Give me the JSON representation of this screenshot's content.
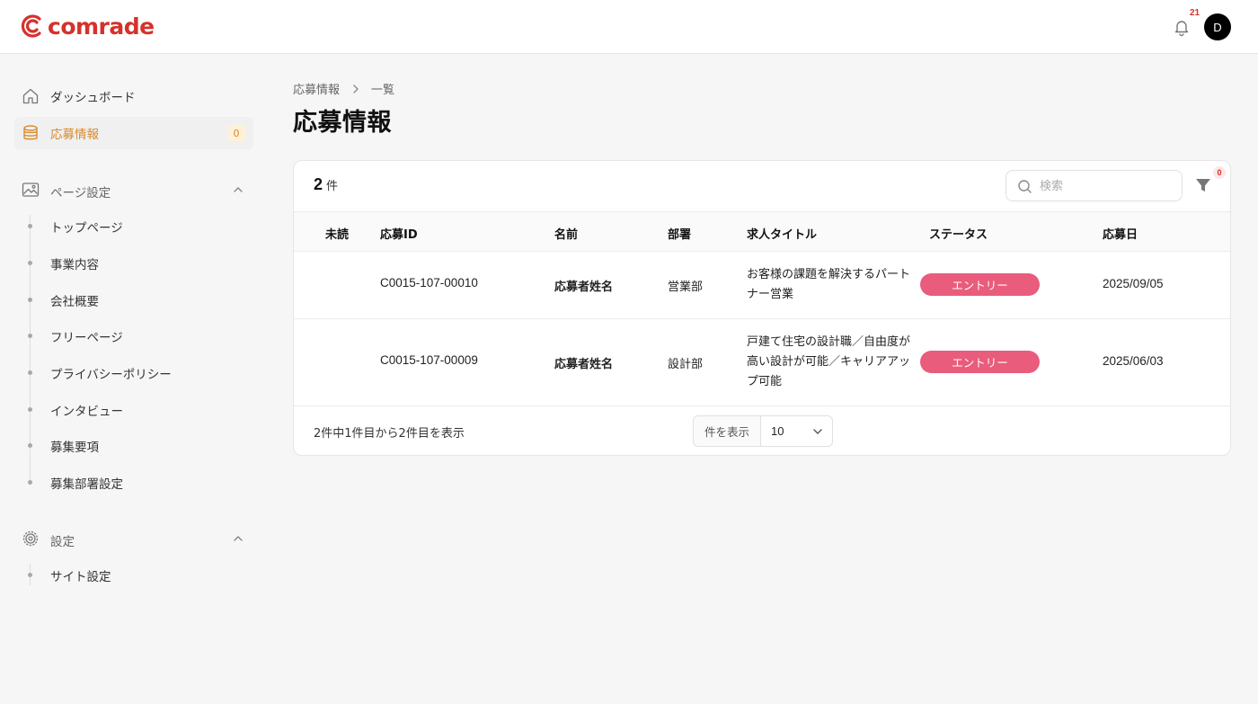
{
  "header": {
    "logo_text": "comrade",
    "notification_count": "21",
    "avatar_initial": "D"
  },
  "sidebar": {
    "dashboard": "ダッシュボード",
    "applications": {
      "label": "応募情報",
      "badge": "0"
    },
    "page_settings": {
      "label": "ページ設定",
      "items": [
        "トップページ",
        "事業内容",
        "会社概要",
        "フリーページ",
        "プライバシーポリシー",
        "インタビュー",
        "募集要項",
        "募集部署設定"
      ]
    },
    "settings": {
      "label": "設定",
      "items": [
        "サイト設定"
      ]
    }
  },
  "breadcrumb": {
    "parent": "応募情報",
    "current": "一覧"
  },
  "page_title": "応募情報",
  "list": {
    "count": "2",
    "count_unit": "件",
    "search_placeholder": "検索",
    "filter_count": "0",
    "columns": [
      "未読",
      "応募ID",
      "名前",
      "部署",
      "求人タイトル",
      "ステータス",
      "応募日"
    ],
    "rows": [
      {
        "unread": "",
        "id": "C0015-107-00010",
        "name": "応募者姓名",
        "department": "営業部",
        "job_title": "お客様の課題を解決するパートナー営業",
        "status": "エントリー",
        "date": "2025/09/05"
      },
      {
        "unread": "",
        "id": "C0015-107-00009",
        "name": "応募者姓名",
        "department": "設計部",
        "job_title": "戸建て住宅の設計職／自由度が高い設計が可能／キャリアアップ可能",
        "status": "エントリー",
        "date": "2025/06/03"
      }
    ],
    "summary": "2件中1件目から2件目を表示",
    "per_page_label": "件を表示",
    "per_page_value": "10"
  },
  "colors": {
    "brand": "#d6312b",
    "accent": "#d88a2c",
    "status_entry": "#e95c7b"
  }
}
